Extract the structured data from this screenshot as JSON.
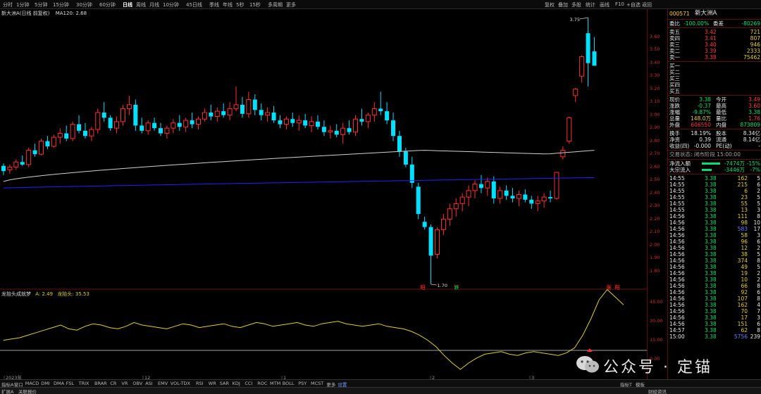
{
  "topbar": {
    "periods": [
      "分时",
      "1分钟",
      "5分钟",
      "15分钟",
      "30分钟",
      "60分钟",
      "日线",
      "周线",
      "月线",
      "10分钟",
      "45日线",
      "季线",
      "年线",
      "5秒",
      "15秒",
      "多周期",
      "更多"
    ],
    "active_period": "日线",
    "tools": [
      "复权",
      "叠加",
      "多股",
      "统计",
      "画线",
      "F10",
      "+自选",
      "返回"
    ]
  },
  "chart": {
    "title": "新大洲A(日线 前复权)",
    "ma_label": "MA120: 2.68",
    "y_ticks": [
      "3.60",
      "3.50",
      "3.40",
      "3.30",
      "3.20",
      "3.10",
      "3.00",
      "2.90",
      "2.80",
      "2.70",
      "2.60",
      "2.50",
      "2.40",
      "2.30",
      "2.20",
      "2.10",
      "2.00",
      "1.90",
      "1.80"
    ],
    "high_label": "3.75",
    "low_label": "1.70",
    "markers": [
      {
        "text": "阳",
        "color": "#ff3c3c"
      },
      {
        "text": "跌",
        "color": "#00e070"
      },
      {
        "text": "涨",
        "color": "#ff3c3c"
      },
      {
        "text": "阳",
        "color": "#ff3c3c"
      }
    ],
    "x_labels": [
      "2023年",
      "12",
      "1",
      "2",
      "3"
    ],
    "colors": {
      "up": "#ff3030",
      "down": "#00e0ff",
      "ma_white": "#d0d0d0",
      "ma_blue": "#2222ff",
      "indicator": "#e0d020"
    }
  },
  "subchart": {
    "title": "龙抬头成就梦",
    "a_label": "A: 2.49",
    "b_label": "龙抬头: 35.53",
    "y_ticks": [
      "45.00",
      "30.00",
      "15.00",
      "0.00"
    ]
  },
  "panel": {
    "code": "000571",
    "name": "新大洲A",
    "ratio": {
      "label": "委比",
      "value": "-100.00%",
      "label2": "委差",
      "value2": "-80269"
    },
    "asks": [
      {
        "label": "卖五",
        "price": "3.42",
        "vol": "721"
      },
      {
        "label": "卖四",
        "price": "3.41",
        "vol": "807"
      },
      {
        "label": "卖三",
        "price": "3.40",
        "vol": "946"
      },
      {
        "label": "卖二",
        "price": "3.39",
        "vol": "2333"
      },
      {
        "label": "卖一",
        "price": "3.38",
        "vol": "75462"
      }
    ],
    "bids": [
      "买一",
      "买二",
      "买三",
      "买四",
      "买五"
    ],
    "stats": [
      {
        "l1": "现价",
        "v1": "3.38",
        "l2": "今开",
        "v2": "3.49"
      },
      {
        "l1": "涨跌",
        "v1": "-0.37",
        "l2": "最高",
        "v2": "3.60"
      },
      {
        "l1": "涨幅",
        "v1": "-9.87%",
        "l2": "最低",
        "v2": "3.38"
      },
      {
        "l1": "总量",
        "v1": "148.0万",
        "l2": "量比",
        "v2": "1.76"
      },
      {
        "l1": "外盘",
        "v1": "606550",
        "l2": "内盘",
        "v2": "873809"
      }
    ],
    "stats2": [
      {
        "l1": "换手",
        "v1": "18.19%",
        "l2": "股本",
        "v2": "8.34亿"
      },
      {
        "l1": "净资",
        "v1": "0.39",
        "l2": "流通",
        "v2": "8.14亿"
      },
      {
        "l1": "收益(四)",
        "v1": "-0.000",
        "l2": "PE(动)",
        "v2": "-"
      }
    ],
    "trade_status": "交易状态: 闭市阶段 15:00:00",
    "flows": [
      {
        "label": "净流入额",
        "value": "-7474万",
        "pct": "-15%"
      },
      {
        "label": "大宗流入",
        "value": "-3446万",
        "pct": "-7%"
      }
    ],
    "ticks": [
      {
        "t": "14:55",
        "p": "3.38",
        "v": "162",
        "n": "5"
      },
      {
        "t": "14:55",
        "p": "3.38",
        "v": "215",
        "n": "6"
      },
      {
        "t": "14:55",
        "p": "3.38",
        "v": "6",
        "n": "2"
      },
      {
        "t": "14:55",
        "p": "3.38",
        "v": "23",
        "n": "5"
      },
      {
        "t": "14:55",
        "p": "3.38",
        "v": "55",
        "n": "5"
      },
      {
        "t": "14:55",
        "p": "3.38",
        "v": "13",
        "n": "3"
      },
      {
        "t": "14:56",
        "p": "3.38",
        "v": "111",
        "n": "8"
      },
      {
        "t": "14:56",
        "p": "3.38",
        "v": "98",
        "n": "10"
      },
      {
        "t": "14:56",
        "p": "3.38",
        "v": "583",
        "n": "17"
      },
      {
        "t": "14:56",
        "p": "3.38",
        "v": "58",
        "n": "3"
      },
      {
        "t": "14:56",
        "p": "3.38",
        "v": "96",
        "n": "6"
      },
      {
        "t": "14:56",
        "p": "3.38",
        "v": "12",
        "n": "2"
      },
      {
        "t": "14:56",
        "p": "3.38",
        "v": "38",
        "n": "5"
      },
      {
        "t": "14:56",
        "p": "3.38",
        "v": "374",
        "n": "8"
      },
      {
        "t": "14:56",
        "p": "3.38",
        "v": "49",
        "n": "5"
      },
      {
        "t": "14:56",
        "p": "3.38",
        "v": "19",
        "n": "2"
      },
      {
        "t": "14:56",
        "p": "3.38",
        "v": "10",
        "n": "2"
      },
      {
        "t": "14:56",
        "p": "3.38",
        "v": "66",
        "n": "8"
      },
      {
        "t": "14:56",
        "p": "3.38",
        "v": "92",
        "n": "6"
      },
      {
        "t": "14:56",
        "p": "3.38",
        "v": "107",
        "n": "8"
      },
      {
        "t": "14:56",
        "p": "3.38",
        "v": "162",
        "n": "4"
      },
      {
        "t": "14:56",
        "p": "3.38",
        "v": "70",
        "n": "7"
      },
      {
        "t": "14:56",
        "p": "3.38",
        "v": "17",
        "n": "3"
      },
      {
        "t": "14:56",
        "p": "3.38",
        "v": "151",
        "n": "6"
      },
      {
        "t": "14:57",
        "p": "3.38",
        "v": "62",
        "n": "8"
      },
      {
        "t": "15:00",
        "p": "3.38",
        "v": "5756",
        "n": "239"
      }
    ]
  },
  "bottombar": {
    "indicators": [
      "指标A",
      "窗口",
      "MACD",
      "DMI",
      "DMA",
      "FSL",
      "TRIX",
      "BRAR",
      "CR",
      "VR",
      "OBV",
      "ASI",
      "EMV",
      "VOL-TDX",
      "RSI",
      "WR",
      "SAR",
      "KDJ",
      "CCI",
      "ROC",
      "MTM",
      "BOLL",
      "PSY",
      "MCST",
      "更多",
      "设置"
    ],
    "right": [
      "指标T",
      "模板"
    ]
  },
  "statusbar": {
    "left": [
      "扩展A",
      "关联报价"
    ],
    "right": "财经资讯"
  },
  "watermark": {
    "text": "公众号 · 定锚"
  },
  "chart_data": {
    "type": "candlestick",
    "ohlc": [
      [
        2.61,
        2.63,
        2.54,
        2.57
      ],
      [
        2.58,
        2.62,
        2.55,
        2.6
      ],
      [
        2.6,
        2.66,
        2.58,
        2.64
      ],
      [
        2.64,
        2.69,
        2.61,
        2.62
      ],
      [
        2.62,
        2.75,
        2.6,
        2.73
      ],
      [
        2.73,
        2.78,
        2.68,
        2.7
      ],
      [
        2.7,
        2.82,
        2.69,
        2.8
      ],
      [
        2.8,
        2.84,
        2.74,
        2.76
      ],
      [
        2.76,
        2.85,
        2.75,
        2.83
      ],
      [
        2.83,
        2.9,
        2.78,
        2.86
      ],
      [
        2.86,
        2.92,
        2.8,
        2.82
      ],
      [
        2.82,
        2.95,
        2.8,
        2.93
      ],
      [
        2.93,
        3.0,
        2.86,
        2.88
      ],
      [
        2.88,
        2.94,
        2.82,
        2.84
      ],
      [
        2.84,
        2.91,
        2.8,
        2.89
      ],
      [
        2.89,
        3.05,
        2.86,
        3.02
      ],
      [
        3.02,
        3.1,
        2.95,
        2.98
      ],
      [
        2.98,
        3.0,
        2.88,
        2.9
      ],
      [
        2.9,
        2.99,
        2.86,
        2.95
      ],
      [
        2.95,
        3.08,
        2.92,
        3.05
      ],
      [
        3.05,
        3.15,
        3.0,
        3.08
      ],
      [
        3.08,
        3.12,
        2.88,
        2.92
      ],
      [
        2.92,
        2.98,
        2.86,
        2.88
      ],
      [
        2.88,
        2.96,
        2.85,
        2.94
      ],
      [
        2.94,
        2.98,
        2.88,
        2.9
      ],
      [
        2.9,
        2.94,
        2.84,
        2.86
      ],
      [
        2.86,
        2.92,
        2.82,
        2.9
      ],
      [
        2.9,
        2.97,
        2.86,
        2.94
      ],
      [
        2.94,
        3.0,
        2.88,
        2.91
      ],
      [
        2.91,
        2.98,
        2.87,
        2.96
      ],
      [
        2.96,
        3.02,
        2.9,
        2.93
      ],
      [
        2.93,
        2.99,
        2.89,
        2.97
      ],
      [
        2.97,
        3.05,
        2.95,
        3.02
      ],
      [
        3.02,
        3.08,
        2.96,
        2.99
      ],
      [
        2.99,
        3.06,
        2.95,
        3.03
      ],
      [
        3.03,
        3.09,
        2.98,
        3.0
      ],
      [
        3.0,
        3.1,
        2.96,
        3.05
      ],
      [
        3.05,
        3.22,
        3.03,
        3.08
      ],
      [
        3.08,
        3.14,
        2.98,
        3.01
      ],
      [
        3.01,
        3.18,
        2.98,
        3.12
      ],
      [
        3.12,
        3.16,
        3.0,
        3.04
      ],
      [
        3.04,
        3.09,
        2.96,
        3.0
      ],
      [
        3.0,
        3.06,
        2.95,
        3.02
      ],
      [
        3.02,
        3.07,
        2.94,
        2.96
      ],
      [
        2.96,
        3.0,
        2.9,
        2.93
      ],
      [
        2.93,
        2.99,
        2.89,
        2.97
      ],
      [
        2.97,
        3.02,
        2.91,
        2.94
      ],
      [
        2.94,
        3.0,
        2.88,
        2.96
      ],
      [
        2.96,
        3.01,
        2.9,
        2.92
      ],
      [
        2.92,
        2.99,
        2.87,
        2.95
      ],
      [
        2.95,
        3.0,
        2.89,
        2.91
      ],
      [
        2.91,
        2.96,
        2.84,
        2.87
      ],
      [
        2.87,
        2.92,
        2.82,
        2.88
      ],
      [
        2.88,
        2.93,
        2.83,
        2.85
      ],
      [
        2.85,
        2.94,
        2.78,
        2.9
      ],
      [
        2.9,
        2.96,
        2.85,
        2.87
      ],
      [
        2.87,
        3.0,
        2.84,
        2.97
      ],
      [
        2.97,
        3.05,
        2.92,
        2.95
      ],
      [
        2.95,
        3.02,
        2.9,
        3.0
      ],
      [
        3.0,
        3.1,
        2.95,
        3.05
      ],
      [
        3.05,
        3.18,
        3.0,
        3.03
      ],
      [
        3.03,
        3.1,
        2.93,
        2.96
      ],
      [
        2.96,
        3.02,
        2.8,
        2.84
      ],
      [
        2.84,
        2.88,
        2.68,
        2.72
      ],
      [
        2.72,
        2.75,
        2.6,
        2.62
      ],
      [
        2.62,
        2.68,
        2.44,
        2.48
      ],
      [
        2.45,
        2.48,
        2.2,
        2.24
      ],
      [
        2.18,
        2.22,
        2.12,
        2.14
      ],
      [
        2.14,
        2.16,
        1.7,
        1.92
      ],
      [
        1.93,
        2.14,
        1.9,
        2.12
      ],
      [
        2.12,
        2.24,
        2.08,
        2.2
      ],
      [
        2.2,
        2.32,
        2.15,
        2.28
      ],
      [
        2.28,
        2.36,
        2.22,
        2.32
      ],
      [
        2.32,
        2.4,
        2.26,
        2.37
      ],
      [
        2.37,
        2.46,
        2.3,
        2.42
      ],
      [
        2.42,
        2.5,
        2.36,
        2.47
      ],
      [
        2.47,
        2.54,
        2.4,
        2.44
      ],
      [
        2.44,
        2.52,
        2.38,
        2.49
      ],
      [
        2.49,
        2.53,
        2.32,
        2.36
      ],
      [
        2.36,
        2.45,
        2.32,
        2.42
      ],
      [
        2.42,
        2.46,
        2.35,
        2.38
      ],
      [
        2.38,
        2.44,
        2.33,
        2.36
      ],
      [
        2.36,
        2.42,
        2.3,
        2.39
      ],
      [
        2.39,
        2.43,
        2.33,
        2.35
      ],
      [
        2.35,
        2.38,
        2.28,
        2.32
      ],
      [
        2.32,
        2.38,
        2.26,
        2.34
      ],
      [
        2.34,
        2.4,
        2.29,
        2.37
      ],
      [
        2.37,
        2.42,
        2.33,
        2.36
      ],
      [
        2.36,
        2.56,
        2.35,
        2.56
      ],
      [
        2.68,
        2.76,
        2.66,
        2.73
      ],
      [
        2.8,
        2.99,
        2.78,
        2.98
      ],
      [
        3.15,
        3.21,
        3.1,
        3.2
      ],
      [
        3.3,
        3.46,
        3.25,
        3.45
      ],
      [
        3.63,
        3.75,
        3.22,
        3.4
      ],
      [
        3.49,
        3.6,
        3.38,
        3.38
      ]
    ],
    "ma_white_endpoints": [
      2.49,
      2.73,
      2.69
    ],
    "ma_blue_endpoints": [
      2.44,
      2.52
    ],
    "y_range": [
      1.7,
      3.75
    ],
    "indicator_values": [
      8,
      9,
      10,
      12,
      14,
      16,
      18,
      20,
      17,
      16,
      19,
      21,
      20,
      18,
      17,
      19,
      22,
      20,
      19,
      18,
      17,
      19,
      21,
      20,
      18,
      19,
      20,
      21,
      19,
      18,
      20,
      22,
      21,
      19,
      20,
      21,
      22,
      20,
      19,
      21,
      22,
      23,
      21,
      20,
      19,
      20,
      21,
      19,
      18,
      17,
      15,
      12,
      8,
      3,
      -4,
      -10,
      -15,
      -10,
      -6,
      -3,
      -2,
      -1,
      -3,
      -4,
      -2,
      -1,
      -2,
      -3,
      -4,
      -2,
      2,
      12,
      25,
      40,
      48,
      42,
      36
    ],
    "indicator_range": [
      -15,
      50
    ]
  }
}
